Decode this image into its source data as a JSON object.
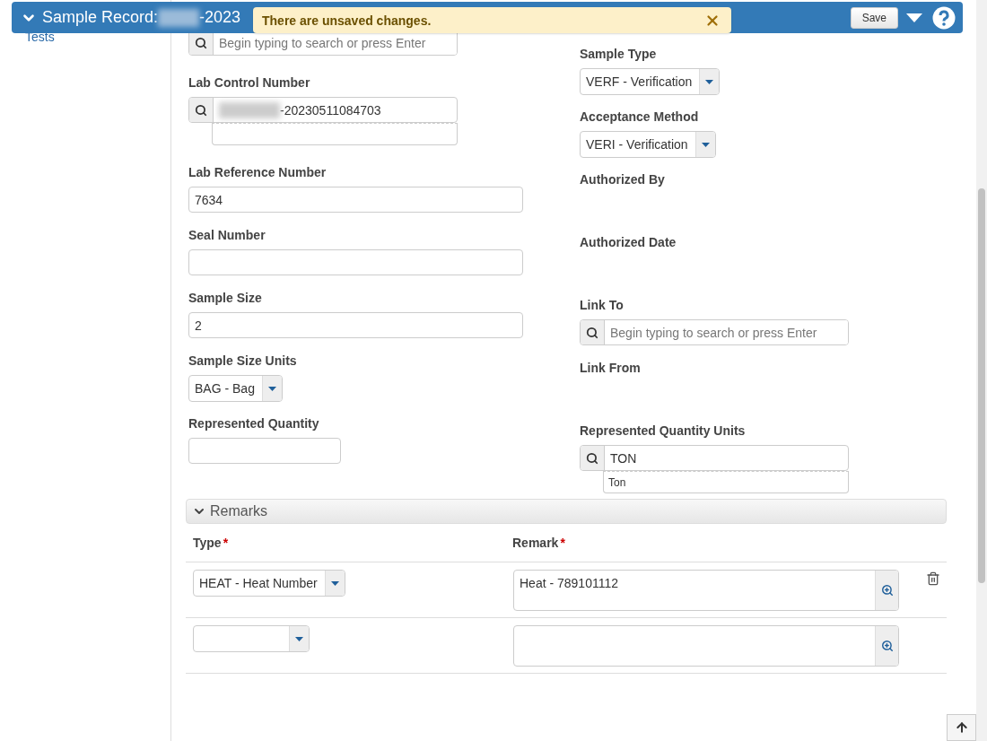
{
  "header": {
    "title": "Sample Record:",
    "redacted": true,
    "title_tail": "-2023",
    "save": "Save"
  },
  "toast": {
    "message": "There are unsaved changes."
  },
  "sidebar": {
    "items": [
      {
        "label": "Tests"
      }
    ]
  },
  "left_fields": [
    {
      "kind": "search",
      "placeholder": "Begin typing to search or press Enter"
    },
    {
      "kind": "lookup",
      "label": "Lab Control Number",
      "redacted": true,
      "value": "-20230511084703"
    },
    {
      "kind": "text",
      "label": "Lab Reference Number",
      "value": "7634"
    },
    {
      "kind": "text",
      "label": "Seal Number"
    },
    {
      "kind": "text",
      "label": "Sample Size",
      "value": "2"
    },
    {
      "kind": "select",
      "label": "Sample Size Units",
      "value": "BAG - Bag"
    },
    {
      "kind": "small_text",
      "label": "Represented Quantity"
    }
  ],
  "right_fields": [
    {
      "kind": "select",
      "label": "Sample Type",
      "value": "VERF - Verification"
    },
    {
      "kind": "select",
      "label": "Acceptance Method",
      "value": "VERI - Verification"
    },
    {
      "kind": "none",
      "label": "Authorized By"
    },
    {
      "kind": "none",
      "label": "Authorized Date"
    },
    {
      "kind": "search",
      "label": "Link To",
      "placeholder": "Begin typing to search or press Enter"
    },
    {
      "kind": "none",
      "label": "Link From"
    },
    {
      "kind": "lookup",
      "label": "Represented Quantity Units",
      "value": "TON",
      "suggestion": "Ton"
    }
  ],
  "remarks": {
    "title": "Remarks",
    "expanded": true,
    "columns": [
      {
        "label": "Type",
        "mark": "*"
      },
      {
        "label": "Remark",
        "mark": "*"
      }
    ],
    "rows": [
      {
        "type": "HEAT - Heat Number",
        "remark": "Heat - 789101112",
        "deletable": true
      },
      {
        "deletable": false
      }
    ]
  }
}
